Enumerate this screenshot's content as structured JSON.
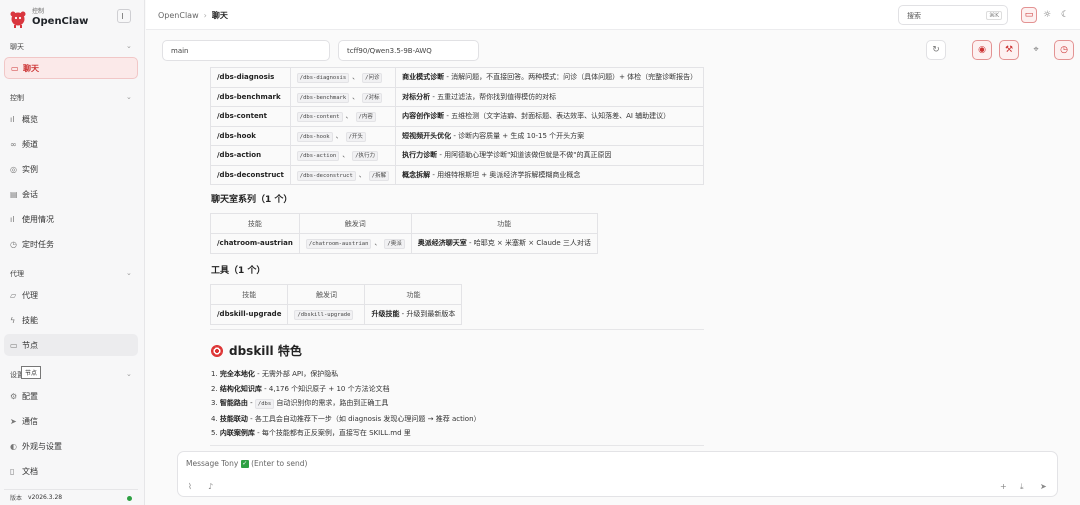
{
  "sidebar": {
    "brand_small": "控制",
    "brand_name": "OpenClaw",
    "sections": [
      {
        "label": "聊天"
      },
      {
        "label": "控制"
      },
      {
        "label": "代理"
      },
      {
        "label": "设置"
      }
    ],
    "items": [
      {
        "label": "聊天",
        "icon": "chat-icon"
      },
      {
        "label": "概览",
        "icon": "bar-chart-icon"
      },
      {
        "label": "频道",
        "icon": "link-icon"
      },
      {
        "label": "实例",
        "icon": "radio-icon"
      },
      {
        "label": "会话",
        "icon": "document-icon"
      },
      {
        "label": "使用情况",
        "icon": "bar-chart-icon"
      },
      {
        "label": "定时任务",
        "icon": "clock-icon"
      },
      {
        "label": "代理",
        "icon": "folder-icon"
      },
      {
        "label": "技能",
        "icon": "zap-icon"
      },
      {
        "label": "节点",
        "icon": "monitor-icon"
      },
      {
        "label": "配置",
        "icon": "settings-icon"
      },
      {
        "label": "通信",
        "icon": "send-icon"
      },
      {
        "label": "外观与设置",
        "icon": "palette-icon"
      },
      {
        "label": "文档",
        "icon": "book-icon"
      }
    ],
    "tooltip": "节点",
    "version_label": "版本",
    "version_value": "v2026.3.28"
  },
  "topbar": {
    "breadcrumb_root": "OpenClaw",
    "breadcrumb_sep": "›",
    "breadcrumb_current": "聊天",
    "search_placeholder": "搜索",
    "search_shortcut": "⌘K"
  },
  "session": {
    "session_value": "main",
    "model_value": "tcff90/Qwen3.5-9B-AWQ"
  },
  "content": {
    "diag_rows": [
      {
        "skill": "/dbs-diagnosis",
        "trig1": "/dbs-diagnosis",
        "trig2": "/问诊",
        "fn_bold": "商业模式诊断",
        "fn_rest": " - 消解问题，不直接回答。两种模式：问诊（具体问题）+ 体检（完整诊断报告）"
      },
      {
        "skill": "/dbs-benchmark",
        "trig1": "/dbs-benchmark",
        "trig2": "/对标",
        "fn_bold": "对标分析",
        "fn_rest": " - 五重过滤法，帮你找到值得模仿的对标"
      },
      {
        "skill": "/dbs-content",
        "trig1": "/dbs-content",
        "trig2": "/内容",
        "fn_bold": "内容创作诊断",
        "fn_rest": " - 五维检测（文字洁癖、封面标题、表达效率、认知落差、AI 辅助建议）"
      },
      {
        "skill": "/dbs-hook",
        "trig1": "/dbs-hook",
        "trig2": "/开头",
        "fn_bold": "短视频开头优化",
        "fn_rest": " - 诊断内容质量 + 生成 10-15 个开头方案"
      },
      {
        "skill": "/dbs-action",
        "trig1": "/dbs-action",
        "trig2": "/执行力",
        "fn_bold": "执行力诊断",
        "fn_rest": " - 用阿德勒心理学诊断\"知道该做但就是不做\"的真正原因"
      },
      {
        "skill": "/dbs-deconstruct",
        "trig1": "/dbs-deconstruct",
        "trig2": "/拆解",
        "fn_bold": "概念拆解",
        "fn_rest": " - 用维特根斯坦 + 奥派经济学拆解模糊商业概念"
      }
    ],
    "list_sep": "、",
    "chat_heading": "聊天室系列（1 个）",
    "chat_headers": [
      "技能",
      "触发词",
      "功能"
    ],
    "chat_rows": [
      {
        "skill": "/chatroom-austrian",
        "trig1": "/chatroom-austrian",
        "trig2": "/奥派",
        "fn_bold": "奥派经济聊天室",
        "fn_rest": " - 哈耶克 × 米塞斯 × Claude 三人对话"
      }
    ],
    "tools_heading": "工具（1 个）",
    "tools_headers": [
      "技能",
      "触发词",
      "功能"
    ],
    "tools_rows": [
      {
        "skill": "/dbskill-upgrade",
        "trig1": "/dbskill-upgrade",
        "fn_bold": "升级技能",
        "fn_rest": " - 升级到最新版本"
      }
    ],
    "features_heading": "dbskill 特色",
    "features": [
      {
        "num": "1.",
        "bold": "完全本地化",
        "rest": " - 无需外部 API，保护隐私"
      },
      {
        "num": "2.",
        "bold": "结构化知识库",
        "rest": " - 4,176 个知识原子 + 10 个方法论文档"
      },
      {
        "num": "3.",
        "bold": "智能路由",
        "rest_pre": " - ",
        "code": "/dbs",
        "rest": " 自动识别你的需求，路由到正确工具"
      },
      {
        "num": "4.",
        "bold": "技能联动",
        "rest": " - 各工具会自动推荐下一步（如 diagnosis 发现心理问题 → 推荐 action）"
      },
      {
        "num": "5.",
        "bold": "内联案例库",
        "rest": " - 每个技能都有正反案例，直接写在 SKILL.md 里"
      }
    ]
  },
  "composer": {
    "placeholder_pre": "Message Tony",
    "placeholder_post": "(Enter to send)"
  }
}
